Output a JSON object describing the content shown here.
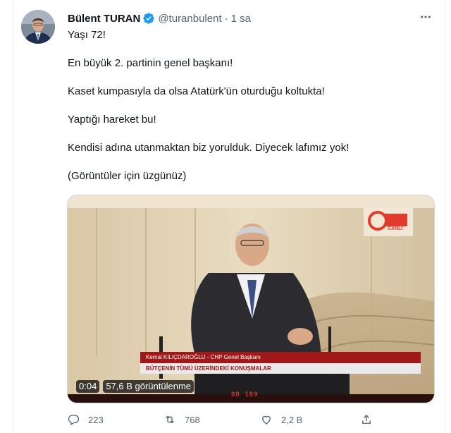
{
  "tweet": {
    "author_name": "Bülent TURAN",
    "handle": "@turanbulent",
    "separator": "·",
    "time": "1 sa",
    "lines": [
      "Yaşı 72!",
      "En büyük 2. partinin genel başkanı!",
      "Kaset kumpasıyla da olsa Atatürk'ün oturduğu koltukta!",
      "Yaptığı hareket bu!",
      "Kendisi adına utanmaktan biz yorulduk. Diyecek lafımız yok!",
      "(Görüntüler için üzgünüz)"
    ]
  },
  "video": {
    "duration": "0:04",
    "views": "57,6 B görüntülenme",
    "lower_third_name": "Kemal KILIÇDAROĞLU - CHP Genel Başkanı",
    "lower_third_caption": "BÜTÇENİN TÜMÜ ÜZERİNDEKİ KONUŞMALAR",
    "channel_logo_text": "CANLI",
    "ticker": "08 189"
  },
  "stats": {
    "replies": "223",
    "retweets": "768",
    "likes": "2,2 B"
  },
  "icons": {
    "verified": "verified-badge-icon",
    "more": "more-horizontal-icon",
    "reply": "reply-icon",
    "retweet": "retweet-icon",
    "like": "heart-icon",
    "share": "share-icon"
  },
  "colors": {
    "verified_blue": "#1d9bf0",
    "secondary_text": "#536471",
    "primary_text": "#0f1419"
  }
}
